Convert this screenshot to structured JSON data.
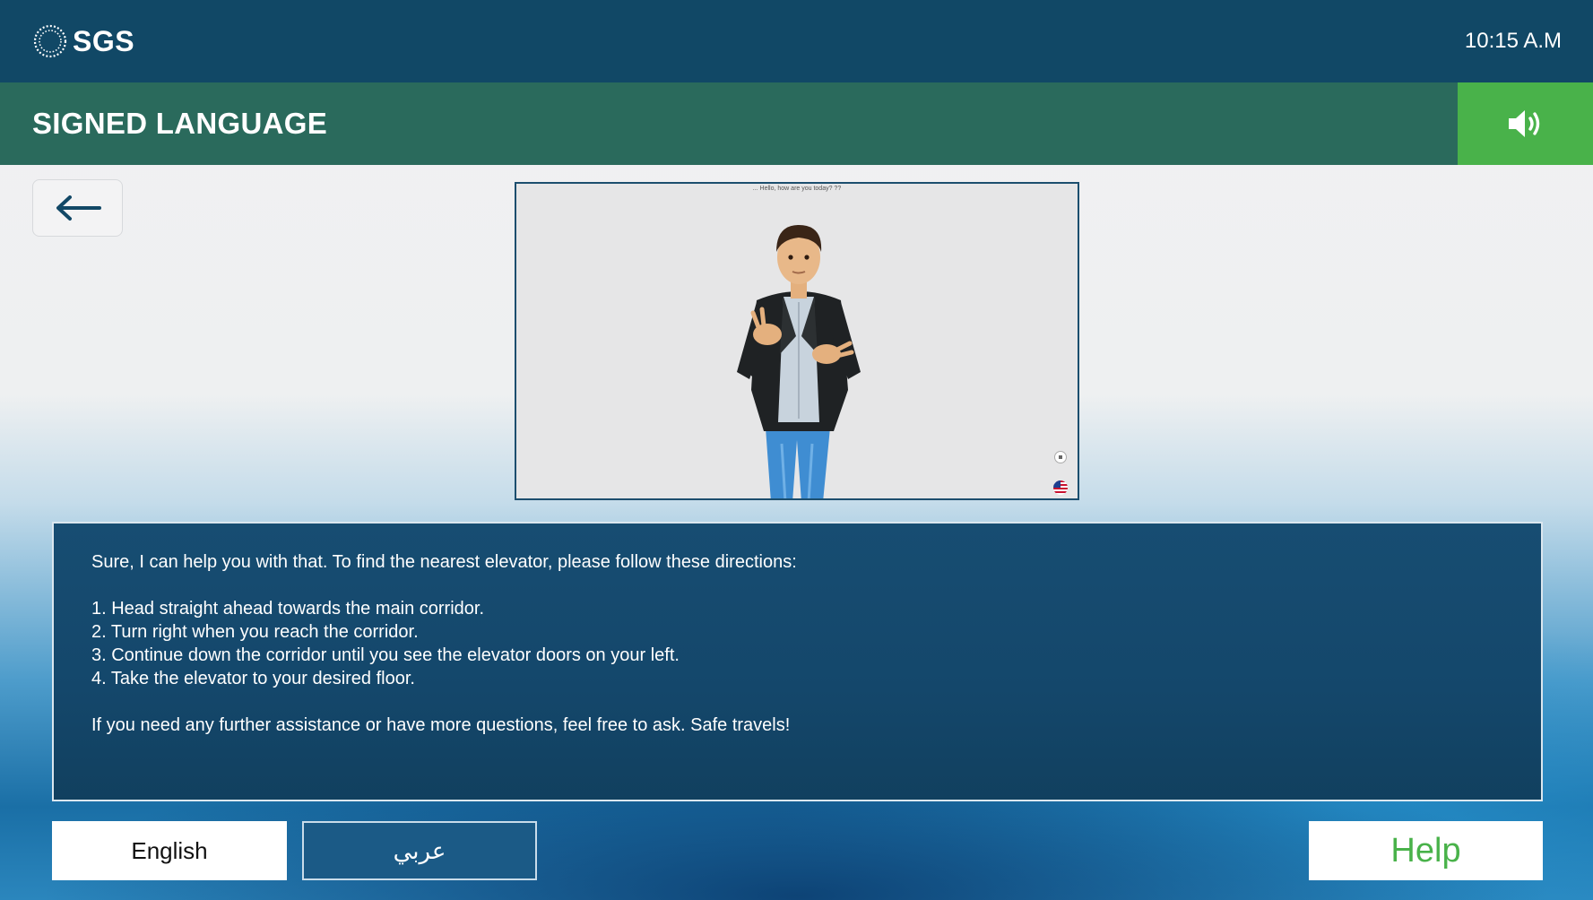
{
  "header": {
    "logo_text": "SGS",
    "time": "10:15 A.M"
  },
  "titlebar": {
    "title": "SIGNED LANGUAGE",
    "sound_icon": "speaker-volume-icon",
    "accent_color": "#49b24a",
    "bar_color": "#2a6a5c"
  },
  "nav": {
    "back_icon": "arrow-left-icon"
  },
  "video": {
    "caption": "... Hello, how are you today? ??",
    "flag_icon": "us-flag-icon"
  },
  "response": {
    "intro": "Sure, I can help you with that. To find the nearest elevator, please follow these directions:",
    "steps": [
      "1. Head straight ahead towards the main corridor.",
      "2. Turn right when you reach the corridor.",
      "3. Continue down the corridor until you see the elevator doors on your left.",
      "4. Take the elevator to your desired floor."
    ],
    "closing": "If you need any further assistance or have more questions, feel free to ask. Safe travels!"
  },
  "footer": {
    "english_label": "English",
    "arabic_label": "عربي",
    "help_label": "Help"
  }
}
